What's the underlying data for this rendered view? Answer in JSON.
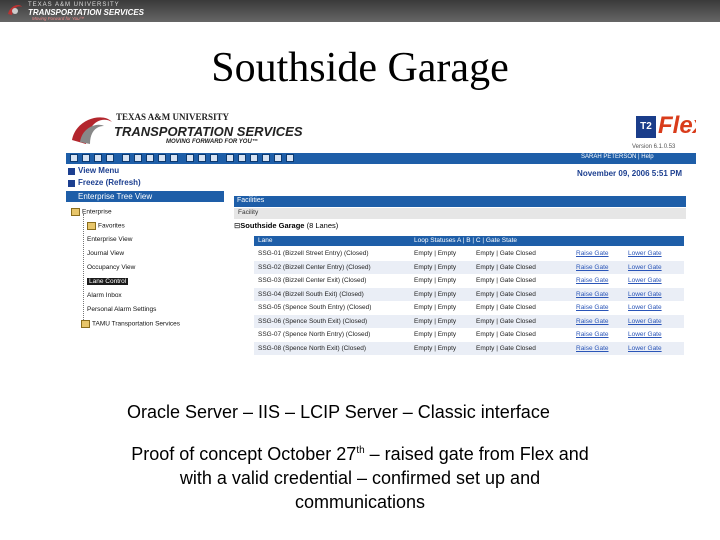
{
  "topbar": {
    "line1": "TEXAS A&M UNIVERSITY",
    "line2": "TRANSPORTATION SERVICES",
    "line3": "Moving Forward for You™"
  },
  "slide_title": "Southside Garage",
  "app": {
    "header": {
      "org_line1": "TEXAS A&M UNIVERSITY",
      "org_line2": "TRANSPORTATION SERVICES",
      "tagline": "MOVING FORWARD FOR YOU™",
      "brand": "Flex",
      "brand_box": "T2",
      "version": "Version 6.1.0.53"
    },
    "toolbar": {
      "user_text": "SARAH PETERSON | Help"
    },
    "nav": {
      "view_menu": "View Menu",
      "freeze": "Freeze (Refresh)",
      "explorer": "Enterprise Tree View"
    },
    "tree": [
      {
        "label": "Enterprise",
        "level": 0
      },
      {
        "label": "Favorites",
        "level": 1
      },
      {
        "label": "Enterprise View",
        "level": 1
      },
      {
        "label": "Journal View",
        "level": 1
      },
      {
        "label": "Occupancy View",
        "level": 1
      },
      {
        "label": "Lane Control",
        "level": 1,
        "selected": true
      },
      {
        "label": "Alarm Inbox",
        "level": 1
      },
      {
        "label": "Personal Alarm Settings",
        "level": 1
      },
      {
        "label": "TAMU Transportation Services",
        "level": 1
      }
    ],
    "content": {
      "date": "November 09, 2006 5:51 PM",
      "breadcrumb": "Facilities",
      "facility_label": "Facility",
      "garage_name": "Southside Garage",
      "garage_count": "(8 Lanes)",
      "columns": [
        "Lane",
        "Loop Statuses A | B | C | Gate State",
        "",
        ""
      ],
      "rows": [
        {
          "lane": "SSG-01 (Bizzell Street Entry) (Closed)",
          "loops": "Empty | Empty",
          "state": "Empty | Gate Closed",
          "raise": "Raise Gate",
          "lower": "Lower Gate"
        },
        {
          "lane": "SSG-02 (Bizzell Center Entry) (Closed)",
          "loops": "Empty | Empty",
          "state": "Empty | Gate Closed",
          "raise": "Raise Gate",
          "lower": "Lower Gate"
        },
        {
          "lane": "SSG-03 (Bizzell Center Exit) (Closed)",
          "loops": "Empty | Empty",
          "state": "Empty | Gate Closed",
          "raise": "Raise Gate",
          "lower": "Lower Gate"
        },
        {
          "lane": "SSG-04 (Bizzell South Exit) (Closed)",
          "loops": "Empty | Empty",
          "state": "Empty | Gate Closed",
          "raise": "Raise Gate",
          "lower": "Lower Gate"
        },
        {
          "lane": "SSG-05 (Spence South Entry) (Closed)",
          "loops": "Empty | Empty",
          "state": "Empty | Gate Closed",
          "raise": "Raise Gate",
          "lower": "Lower Gate"
        },
        {
          "lane": "SSG-06 (Spence South Exit) (Closed)",
          "loops": "Empty | Empty",
          "state": "Empty | Gate Closed",
          "raise": "Raise Gate",
          "lower": "Lower Gate"
        },
        {
          "lane": "SSG-07 (Spence North Entry) (Closed)",
          "loops": "Empty | Empty",
          "state": "Empty | Gate Closed",
          "raise": "Raise Gate",
          "lower": "Lower Gate"
        },
        {
          "lane": "SSG-08 (Spence North Exit) (Closed)",
          "loops": "Empty | Empty",
          "state": "Empty | Gate Closed",
          "raise": "Raise Gate",
          "lower": "Lower Gate"
        }
      ]
    }
  },
  "captions": {
    "line1": "Oracle Server – IIS – LCIP Server – Classic interface",
    "line2_pre": "Proof of concept October 27",
    "line2_sup": "th",
    "line2_post": " – raised gate from Flex and",
    "line3": "with a valid credential – confirmed set up and",
    "line4": "communications"
  }
}
